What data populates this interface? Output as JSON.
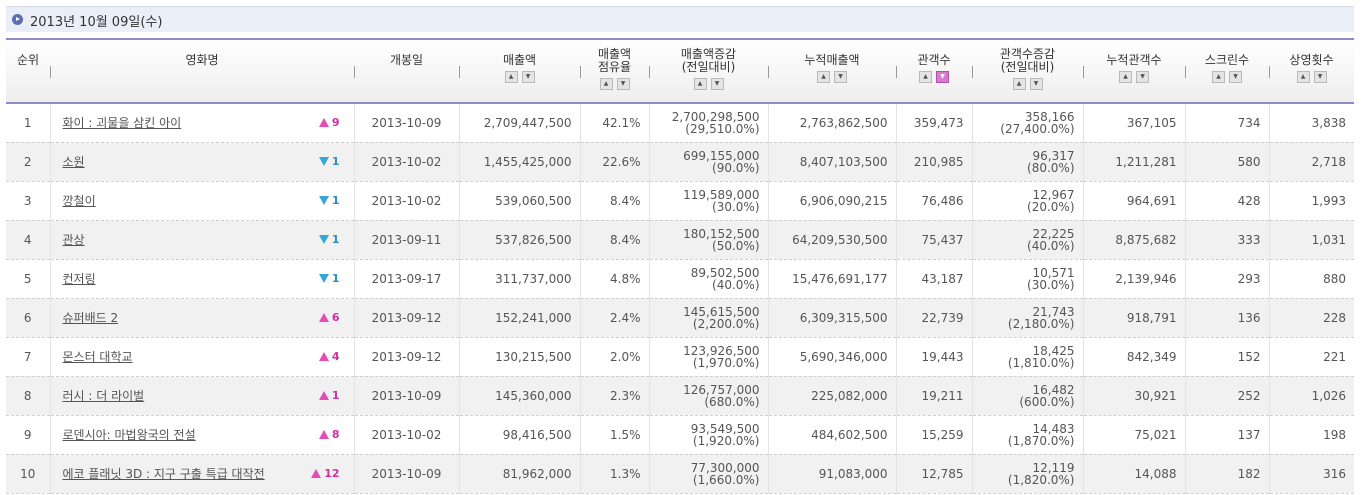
{
  "date_header": "2013년 10월 09일(수)",
  "columns": {
    "rank": "순위",
    "movie": "영화명",
    "release": "개봉일",
    "sales": "매출액",
    "share_1": "매출액",
    "share_2": "점유율",
    "sales_change_1": "매출액증감",
    "sales_change_2": "(전일대비)",
    "cum_sales": "누적매출액",
    "audience": "관객수",
    "aud_change_1": "관객수증감",
    "aud_change_2": "(전일대비)",
    "cum_audience": "누적관객수",
    "screens": "스크린수",
    "shows": "상영횟수"
  },
  "rows": [
    {
      "rank": "1",
      "title": "화이 : 괴물을 삼킨 아이",
      "dir": "up",
      "change": "9",
      "release": "2013-10-09",
      "sales": "2,709,447,500",
      "share": "42.1%",
      "sales_chg": "2,700,298,500",
      "sales_chg_pct": "(29,510.0%)",
      "cum_sales": "2,763,862,500",
      "audience": "359,473",
      "aud_chg": "358,166",
      "aud_chg_pct": "(27,400.0%)",
      "cum_audience": "367,105",
      "screens": "734",
      "shows": "3,838"
    },
    {
      "rank": "2",
      "title": "소원",
      "dir": "down",
      "change": "1",
      "release": "2013-10-02",
      "sales": "1,455,425,000",
      "share": "22.6%",
      "sales_chg": "699,155,000",
      "sales_chg_pct": "(90.0%)",
      "cum_sales": "8,407,103,500",
      "audience": "210,985",
      "aud_chg": "96,317",
      "aud_chg_pct": "(80.0%)",
      "cum_audience": "1,211,281",
      "screens": "580",
      "shows": "2,718"
    },
    {
      "rank": "3",
      "title": "깡철이",
      "dir": "down",
      "change": "1",
      "release": "2013-10-02",
      "sales": "539,060,500",
      "share": "8.4%",
      "sales_chg": "119,589,000",
      "sales_chg_pct": "(30.0%)",
      "cum_sales": "6,906,090,215",
      "audience": "76,486",
      "aud_chg": "12,967",
      "aud_chg_pct": "(20.0%)",
      "cum_audience": "964,691",
      "screens": "428",
      "shows": "1,993"
    },
    {
      "rank": "4",
      "title": "관상",
      "dir": "down",
      "change": "1",
      "release": "2013-09-11",
      "sales": "537,826,500",
      "share": "8.4%",
      "sales_chg": "180,152,500",
      "sales_chg_pct": "(50.0%)",
      "cum_sales": "64,209,530,500",
      "audience": "75,437",
      "aud_chg": "22,225",
      "aud_chg_pct": "(40.0%)",
      "cum_audience": "8,875,682",
      "screens": "333",
      "shows": "1,031"
    },
    {
      "rank": "5",
      "title": "컨저링",
      "dir": "down",
      "change": "1",
      "release": "2013-09-17",
      "sales": "311,737,000",
      "share": "4.8%",
      "sales_chg": "89,502,500",
      "sales_chg_pct": "(40.0%)",
      "cum_sales": "15,476,691,177",
      "audience": "43,187",
      "aud_chg": "10,571",
      "aud_chg_pct": "(30.0%)",
      "cum_audience": "2,139,946",
      "screens": "293",
      "shows": "880"
    },
    {
      "rank": "6",
      "title": "슈퍼배드 2",
      "dir": "up",
      "change": "6",
      "release": "2013-09-12",
      "sales": "152,241,000",
      "share": "2.4%",
      "sales_chg": "145,615,500",
      "sales_chg_pct": "(2,200.0%)",
      "cum_sales": "6,309,315,500",
      "audience": "22,739",
      "aud_chg": "21,743",
      "aud_chg_pct": "(2,180.0%)",
      "cum_audience": "918,791",
      "screens": "136",
      "shows": "228"
    },
    {
      "rank": "7",
      "title": "몬스터 대학교",
      "dir": "up",
      "change": "4",
      "release": "2013-09-12",
      "sales": "130,215,500",
      "share": "2.0%",
      "sales_chg": "123,926,500",
      "sales_chg_pct": "(1,970.0%)",
      "cum_sales": "5,690,346,000",
      "audience": "19,443",
      "aud_chg": "18,425",
      "aud_chg_pct": "(1,810.0%)",
      "cum_audience": "842,349",
      "screens": "152",
      "shows": "221"
    },
    {
      "rank": "8",
      "title": "러시 : 더 라이벌",
      "dir": "up",
      "change": "1",
      "release": "2013-10-09",
      "sales": "145,360,000",
      "share": "2.3%",
      "sales_chg": "126,757,000",
      "sales_chg_pct": "(680.0%)",
      "cum_sales": "225,082,000",
      "audience": "19,211",
      "aud_chg": "16,482",
      "aud_chg_pct": "(600.0%)",
      "cum_audience": "30,921",
      "screens": "252",
      "shows": "1,026"
    },
    {
      "rank": "9",
      "title": "로덴시아: 마법왕국의 전설",
      "dir": "up",
      "change": "8",
      "release": "2013-10-02",
      "sales": "98,416,500",
      "share": "1.5%",
      "sales_chg": "93,549,500",
      "sales_chg_pct": "(1,920.0%)",
      "cum_sales": "484,602,500",
      "audience": "15,259",
      "aud_chg": "14,483",
      "aud_chg_pct": "(1,870.0%)",
      "cum_audience": "75,021",
      "screens": "137",
      "shows": "198"
    },
    {
      "rank": "10",
      "title": "에코 플래닛 3D : 지구 구출 특급 대작전",
      "dir": "up",
      "change": "12",
      "release": "2013-10-09",
      "sales": "81,962,000",
      "share": "1.3%",
      "sales_chg": "77,300,000",
      "sales_chg_pct": "(1,660.0%)",
      "cum_sales": "91,083,000",
      "audience": "12,785",
      "aud_chg": "12,119",
      "aud_chg_pct": "(1,820.0%)",
      "cum_audience": "14,088",
      "screens": "182",
      "shows": "316"
    }
  ]
}
